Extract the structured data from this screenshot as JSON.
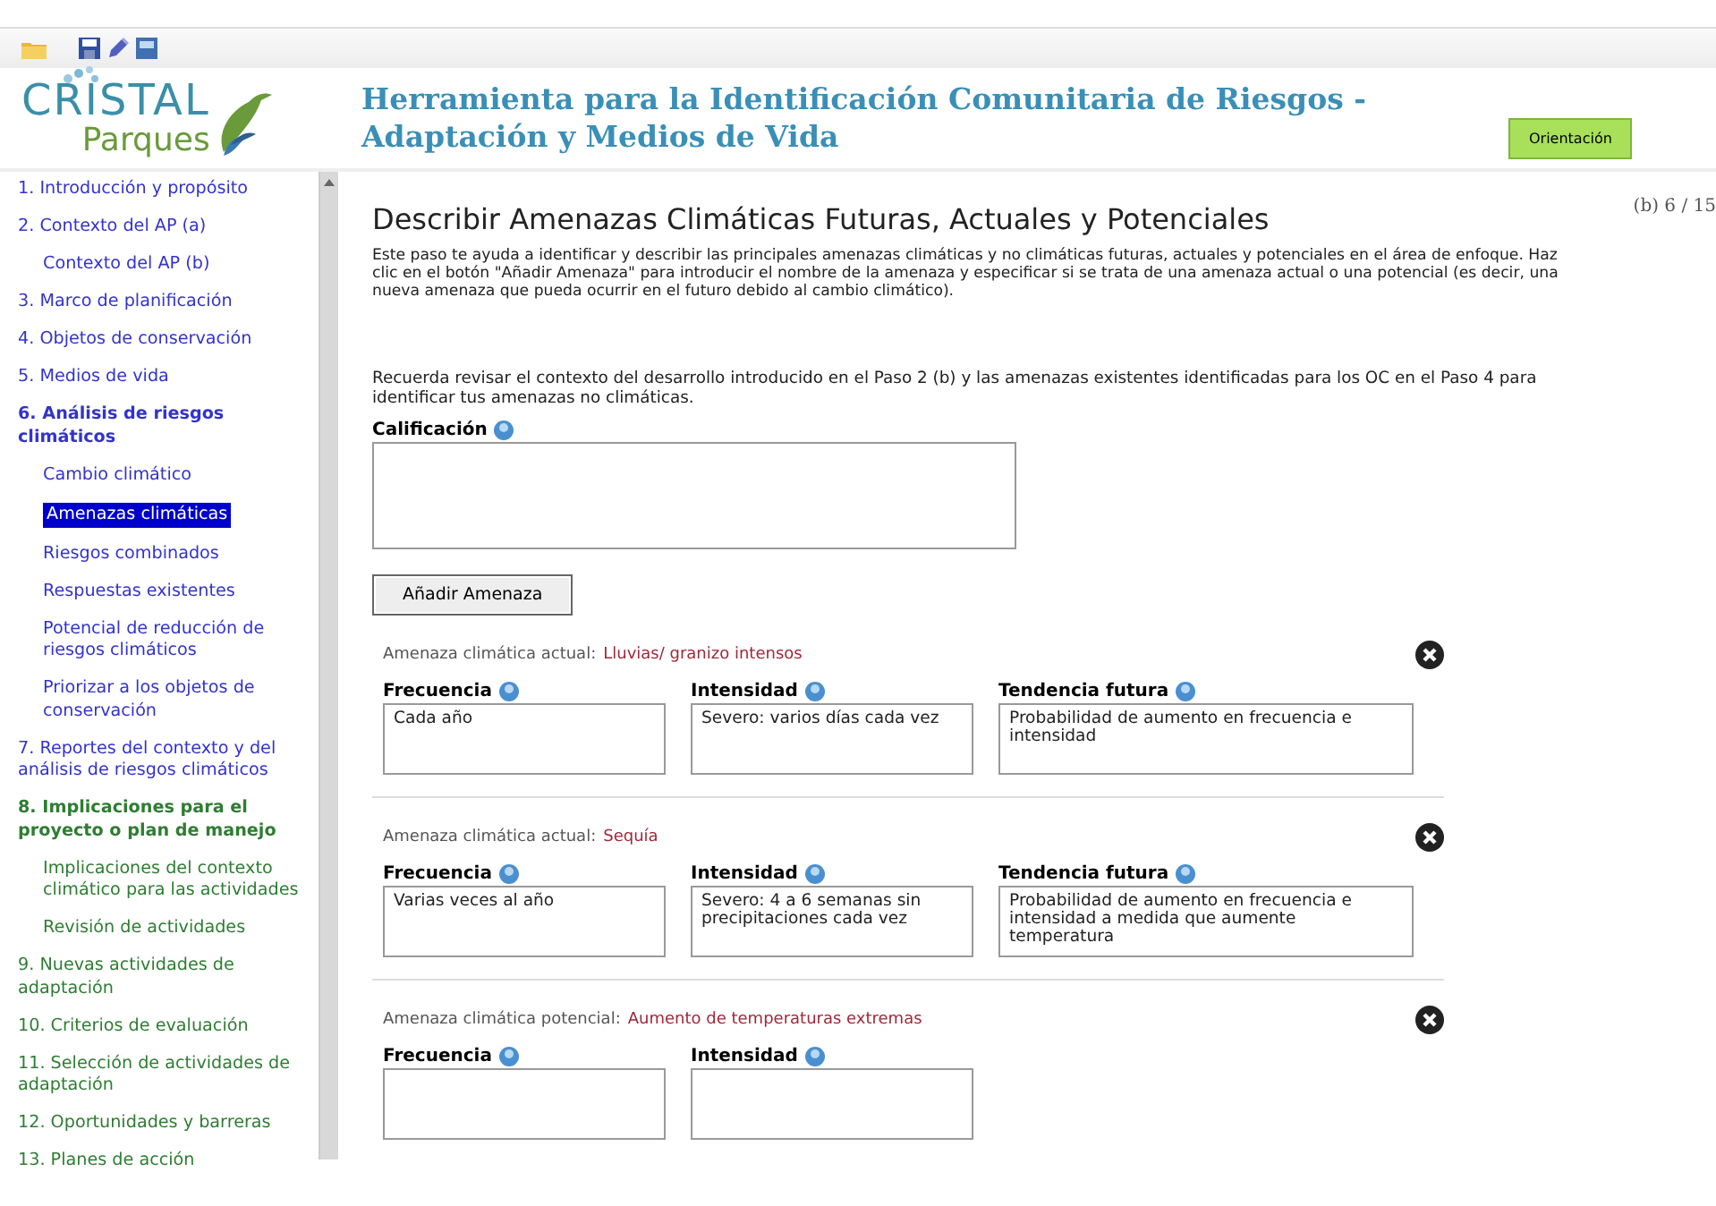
{
  "logo": {
    "name": "CRISTAL",
    "sub": "Parques"
  },
  "header": {
    "title_line1": "Herramienta para la Identificación Comunitaria de Riesgos -",
    "title_line2": "Adaptación y Medios de Vida",
    "button": "Orientación"
  },
  "sidebar": {
    "items": [
      {
        "label": "1. Introducción y propósito",
        "kind": "section",
        "bold": false,
        "selected": false,
        "color": "#3333cc"
      },
      {
        "label": "2. Contexto del AP (a)",
        "kind": "section",
        "bold": false,
        "selected": false,
        "color": "#3333cc"
      },
      {
        "label": "Contexto del AP (b)",
        "kind": "sub",
        "bold": false,
        "selected": false,
        "color": "#3333cc"
      },
      {
        "label": "3. Marco de planificación",
        "kind": "section",
        "bold": false,
        "selected": false,
        "color": "#3333cc"
      },
      {
        "label": "4. Objetos de conservación",
        "kind": "section",
        "bold": false,
        "selected": false,
        "color": "#3333cc"
      },
      {
        "label": "5. Medios de vida",
        "kind": "section",
        "bold": false,
        "selected": false,
        "color": "#3333cc"
      },
      {
        "label": "6. Análisis de riesgos climáticos",
        "kind": "section",
        "bold": true,
        "selected": false,
        "color": "#3333cc"
      },
      {
        "label": "Cambio climático",
        "kind": "sub",
        "bold": false,
        "selected": false,
        "color": "#3333cc"
      },
      {
        "label": "Amenazas climáticas",
        "kind": "sub",
        "bold": false,
        "selected": true,
        "color": "#0000cc"
      },
      {
        "label": "Riesgos combinados",
        "kind": "sub",
        "bold": false,
        "selected": false,
        "color": "#3333cc"
      },
      {
        "label": "Respuestas existentes",
        "kind": "sub",
        "bold": false,
        "selected": false,
        "color": "#3333cc"
      },
      {
        "label": "Potencial de reducción de riesgos climáticos",
        "kind": "sub",
        "bold": false,
        "selected": false,
        "color": "#3333cc"
      },
      {
        "label": "Priorizar a los objetos de conservación",
        "kind": "sub",
        "bold": false,
        "selected": false,
        "color": "#3333cc"
      },
      {
        "label": "7. Reportes del contexto y del análisis de riesgos climáticos",
        "kind": "section",
        "bold": false,
        "selected": false,
        "color": "#3333cc"
      },
      {
        "label": "8. Implicaciones para el proyecto o plan de manejo",
        "kind": "section",
        "bold": true,
        "selected": false,
        "color": "#2e7d32"
      },
      {
        "label": "Implicaciones del contexto climático para las actividades",
        "kind": "sub",
        "bold": false,
        "selected": false,
        "color": "#2e7d32"
      },
      {
        "label": "Revisión de actividades",
        "kind": "sub",
        "bold": false,
        "selected": false,
        "color": "#2e7d32"
      },
      {
        "label": "9. Nuevas actividades de adaptación",
        "kind": "section",
        "bold": false,
        "selected": false,
        "color": "#2e7d32"
      },
      {
        "label": "10. Criterios de evaluación",
        "kind": "section",
        "bold": false,
        "selected": false,
        "color": "#2e7d32"
      },
      {
        "label": "11. Selección de actividades de adaptación",
        "kind": "section",
        "bold": false,
        "selected": false,
        "color": "#2e7d32"
      },
      {
        "label": "12. Oportunidades y barreras",
        "kind": "section",
        "bold": false,
        "selected": false,
        "color": "#2e7d32"
      },
      {
        "label": "13. Planes de acción",
        "kind": "section",
        "bold": false,
        "selected": false,
        "color": "#2e7d32"
      }
    ]
  },
  "main": {
    "title": "Describir Amenazas Climáticas Futuras, Actuales y Potenciales",
    "page": "(b) 6 / 15",
    "intro": "Este paso te ayuda a identificar y describir las principales amenazas climáticas y no climáticas futuras, actuales y potenciales en el área de enfoque. Haz clic en el botón \"Añadir Amenaza\" para introducir el nombre de la amenaza y especificar si se trata de una amenaza actual o una potencial (es decir, una nueva amenaza que pueda ocurrir en el futuro debido al cambio climático).",
    "reminder": "Recuerda revisar el contexto del desarrollo introducido en el Paso 2 (b) y las amenazas existentes identificadas para los OC en el Paso 4 para identificar tus amenazas no climáticas.",
    "rating_label": "Calificación",
    "add_button": "Añadir Amenaza",
    "threats": [
      {
        "type_label": "Amenaza climática actual:",
        "name": "Lluvias/ granizo intensos",
        "fields": [
          {
            "label": "Frecuencia",
            "value": "Cada año",
            "kind": "narrow"
          },
          {
            "label": "Intensidad",
            "value": "Severo: varios días cada vez",
            "kind": "narrow"
          },
          {
            "label": "Tendencia futura",
            "value": "Probabilidad de aumento en frecuencia e intensidad",
            "kind": "wide"
          }
        ]
      },
      {
        "type_label": "Amenaza climática actual:",
        "name": "Sequía",
        "fields": [
          {
            "label": "Frecuencia",
            "value": "Varias veces al año",
            "kind": "narrow"
          },
          {
            "label": "Intensidad",
            "value": "Severo: 4 a 6 semanas sin precipitaciones cada vez",
            "kind": "narrow"
          },
          {
            "label": "Tendencia futura",
            "value": "Probabilidad de aumento en frecuencia e intensidad a medida que aumente temperatura",
            "kind": "wide"
          }
        ]
      },
      {
        "type_label": "Amenaza climática potencial:",
        "name": "Aumento de temperaturas extremas",
        "fields": [
          {
            "label": "Frecuencia",
            "kind": "narrow"
          },
          {
            "label": "Intensidad",
            "kind": "narrow"
          }
        ]
      }
    ]
  }
}
